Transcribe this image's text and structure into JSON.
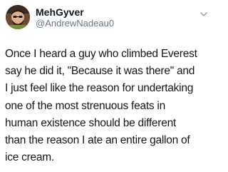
{
  "author": {
    "display_name": "MehGyver",
    "handle": "@AndrewNadeau0",
    "avatar_icon": "profile-photo-avatar"
  },
  "menu_icon": "chevron-down-icon",
  "tweet": {
    "lines": [
      "Once I heard a guy who climbed Everest",
      "say he did it, \"Because it was there\" and",
      "I just feel like the reason for undertaking",
      "one of the most strenuous feats in",
      "human existence should be different",
      "than the reason I ate an entire gallon of",
      "ice cream."
    ]
  },
  "colors": {
    "text": "#14171a",
    "secondary": "#657786",
    "background": "#ffffff"
  }
}
